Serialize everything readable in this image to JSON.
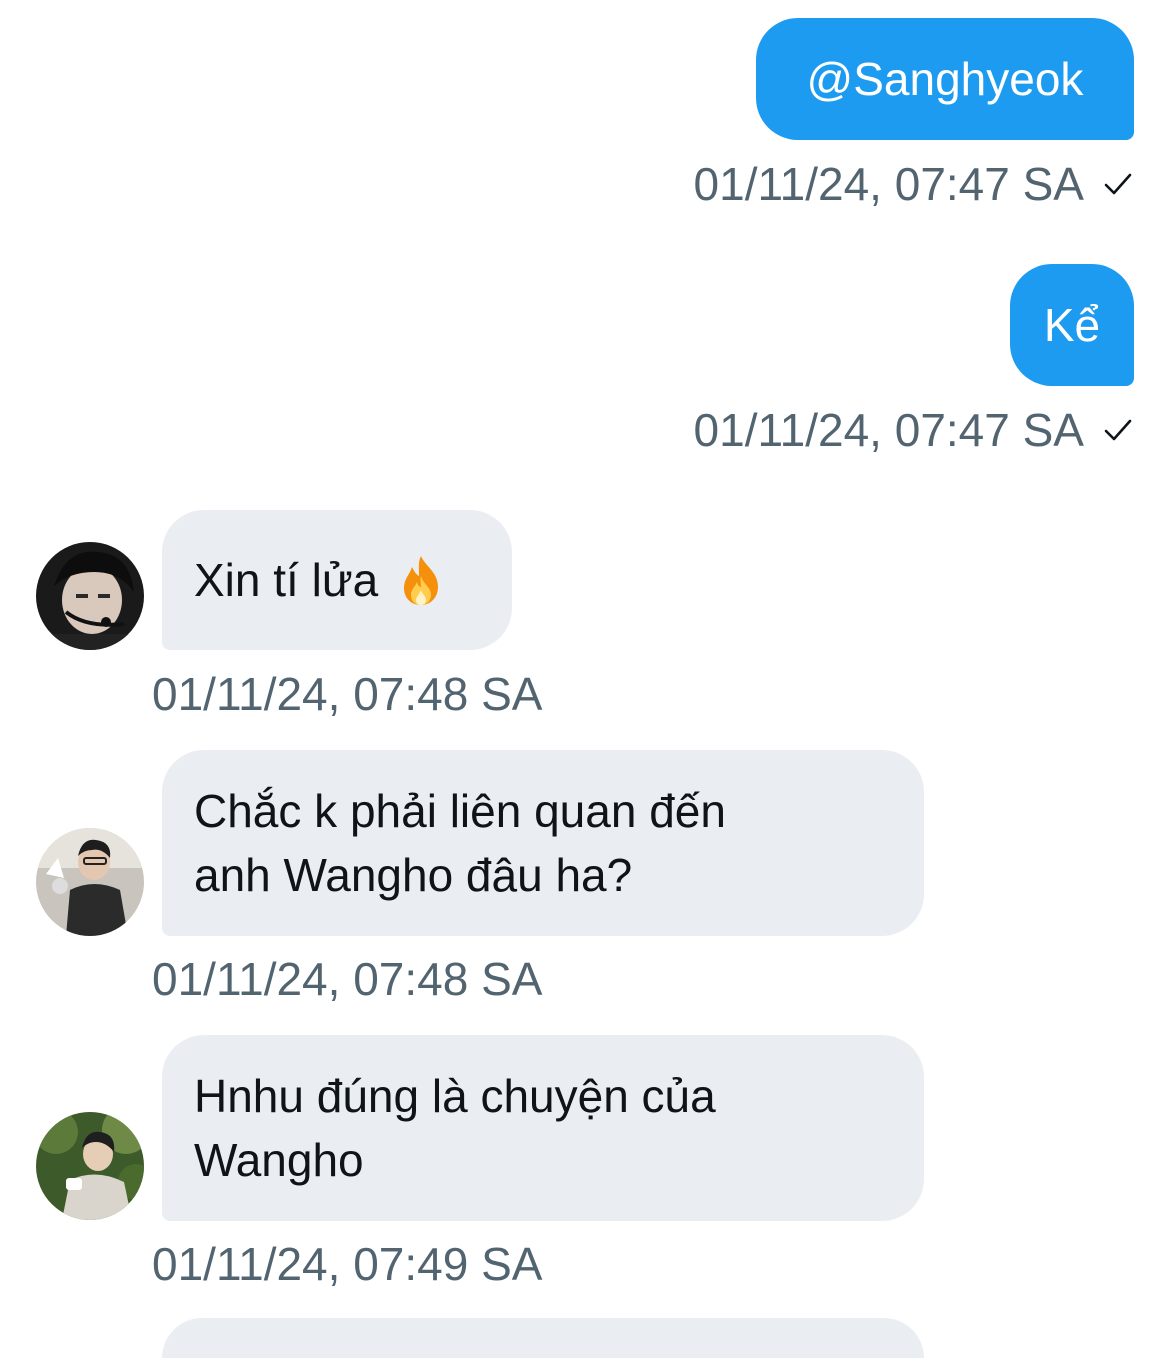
{
  "messages": [
    {
      "direction": "out",
      "text": "@Sanghyeok",
      "timestamp": "01/11/24, 07:47 SA",
      "status_icon": "check-icon"
    },
    {
      "direction": "out",
      "text": "Kể",
      "timestamp": "01/11/24, 07:47 SA",
      "status_icon": "check-icon"
    },
    {
      "direction": "in",
      "text": "Xin tí lửa",
      "emoji": "fire-emoji",
      "timestamp": "01/11/24, 07:48 SA",
      "avatar": "avatar-1"
    },
    {
      "direction": "in",
      "text": "Chắc k phải liên quan đến\nanh Wangho đâu ha?",
      "timestamp": "01/11/24, 07:48 SA",
      "avatar": "avatar-2"
    },
    {
      "direction": "in",
      "text": "Hnhu đúng là chuyện của\nWangho",
      "timestamp": "01/11/24, 07:49 SA",
      "avatar": "avatar-3"
    }
  ],
  "colors": {
    "outgoing_bubble": "#1d9bf0",
    "incoming_bubble": "#eaeef2",
    "timestamp_text": "#536471",
    "message_text": "#0f1419"
  }
}
